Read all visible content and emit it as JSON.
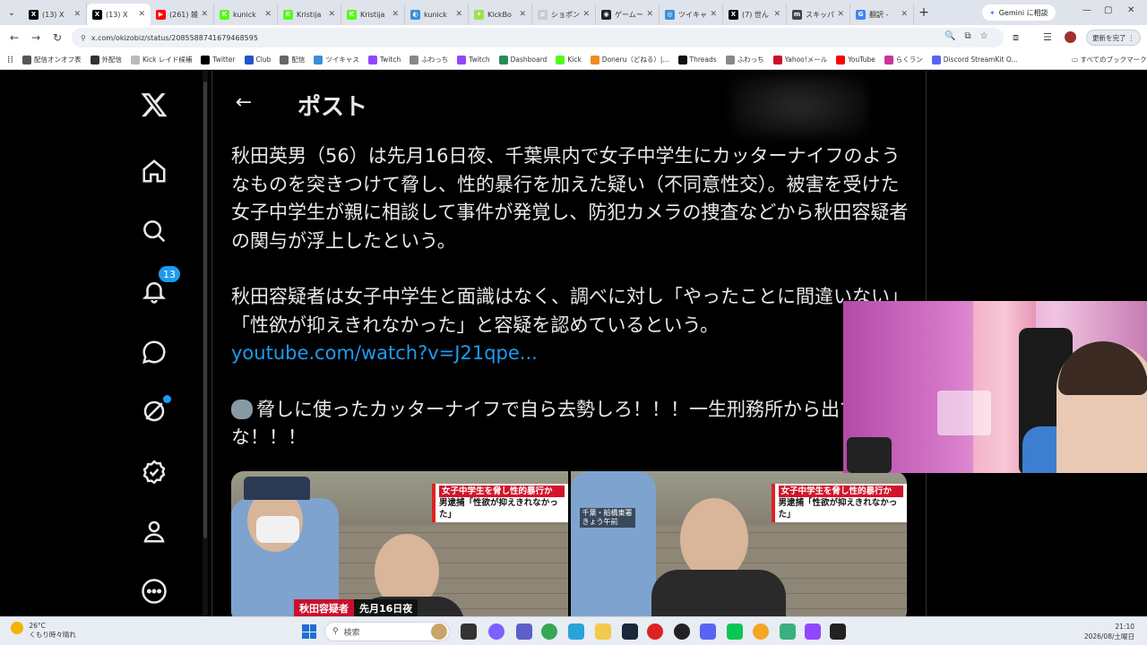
{
  "browser": {
    "tabs": [
      {
        "title": "(13) X",
        "icon": "x-icon",
        "color": "#000000",
        "glyph": "X"
      },
      {
        "title": "(13) X",
        "icon": "x-icon",
        "color": "#000000",
        "glyph": "X",
        "active": true
      },
      {
        "title": "(261) 雑",
        "icon": "youtube-icon",
        "color": "#ff0000",
        "glyph": "▶"
      },
      {
        "title": "kunick",
        "icon": "kick-icon",
        "color": "#53fc18",
        "glyph": "K"
      },
      {
        "title": "Kristija",
        "icon": "kick-icon",
        "color": "#53fc18",
        "glyph": "K"
      },
      {
        "title": "Kristija",
        "icon": "kick-icon",
        "color": "#53fc18",
        "glyph": "K"
      },
      {
        "title": "kunick",
        "icon": "globe-icon",
        "color": "#3a8fd9",
        "glyph": "◐"
      },
      {
        "title": "KickBo",
        "icon": "kickbot-icon",
        "color": "#9be24a",
        "glyph": "✦"
      },
      {
        "title": "ショポン",
        "icon": "doc-icon",
        "color": "#cccccc",
        "glyph": "≡"
      },
      {
        "title": "ゲームー",
        "icon": "game-icon",
        "color": "#222222",
        "glyph": "◉"
      },
      {
        "title": "ツイキャ",
        "icon": "twitcasting-icon",
        "color": "#3a8fd9",
        "glyph": "◎"
      },
      {
        "title": "(7) 世ん",
        "icon": "x-icon",
        "color": "#000000",
        "glyph": "X"
      },
      {
        "title": "スキッパ",
        "icon": "mx-icon",
        "color": "#444444",
        "glyph": "m"
      },
      {
        "title": "翻訳 -",
        "icon": "google-icon",
        "color": "#4285f4",
        "glyph": "G"
      }
    ],
    "gemini_label": "Gemini に相談",
    "url": "x.com/okizobiz/status/2085588741679468595",
    "update_label": "更新を完了 ⋮",
    "bookmarks": [
      {
        "label": "配信オンオフ表",
        "color": "#555555"
      },
      {
        "label": "外配信",
        "color": "#333333"
      },
      {
        "label": "Kick レイド候補",
        "color": "#bbbbbb"
      },
      {
        "label": "Twitter",
        "color": "#000000"
      },
      {
        "label": "Club",
        "color": "#2255cc"
      },
      {
        "label": "配信",
        "color": "#666666"
      },
      {
        "label": "ツイキャス",
        "color": "#3a8fd9"
      },
      {
        "label": "Twitch",
        "color": "#9146ff"
      },
      {
        "label": "ふわっち",
        "color": "#888888"
      },
      {
        "label": "Twitch",
        "color": "#9146ff"
      },
      {
        "label": "Dashboard",
        "color": "#2a8a5a"
      },
      {
        "label": "Kick",
        "color": "#53fc18"
      },
      {
        "label": "Doneru（どねる）|...",
        "color": "#f08a24"
      },
      {
        "label": "Threads",
        "color": "#111111"
      },
      {
        "label": "ふわっち",
        "color": "#888888"
      },
      {
        "label": "Yahoo!メール",
        "color": "#c8102e"
      },
      {
        "label": "YouTube",
        "color": "#ff0000"
      },
      {
        "label": "らくラン",
        "color": "#cc3399"
      },
      {
        "label": "Discord StreamKit O...",
        "color": "#5865f2"
      }
    ],
    "all_bookmarks": "すべてのブックマーク"
  },
  "x": {
    "notifications_badge": "13",
    "post_header": "ポスト",
    "back_label": "←",
    "paragraphs": [
      "秋田英男（56）は先月16日夜、千葉県内で女子中学生にカッターナイフのようなものを突きつけて脅し、性的暴行を加えた疑い（不同意性交）。被害を受けた女子中学生が親に相談して事件が発覚し、防犯カメラの捜査などから秋田容疑者の関与が浮上したという。",
      "秋田容疑者は女子中学生と面識はなく、調べに対し「やったことに間違いない」「性欲が抑えきれなかった」と容疑を認めているという。"
    ],
    "link": "youtube.com/watch?v=J21qpe...",
    "comment": "脅しに使ったカッターナイフで自ら去勢しろ！！！一生刑務所から出てくんな！！！",
    "images": {
      "caption_line1": "女子中学生を脅し性的暴行か",
      "caption_line2": "男逮捕「性欲が抑えきれなかった」",
      "name_label": "秋田容疑者",
      "date_label": "先月16日夜",
      "location_label": "千葉・船橋東署",
      "time_label": "きょう午前"
    }
  },
  "taskbar": {
    "temperature": "26°C",
    "weather": "くもり時々晴れ",
    "search_placeholder": "検索",
    "time": "21:10",
    "date": "2026/08/土曜日"
  }
}
